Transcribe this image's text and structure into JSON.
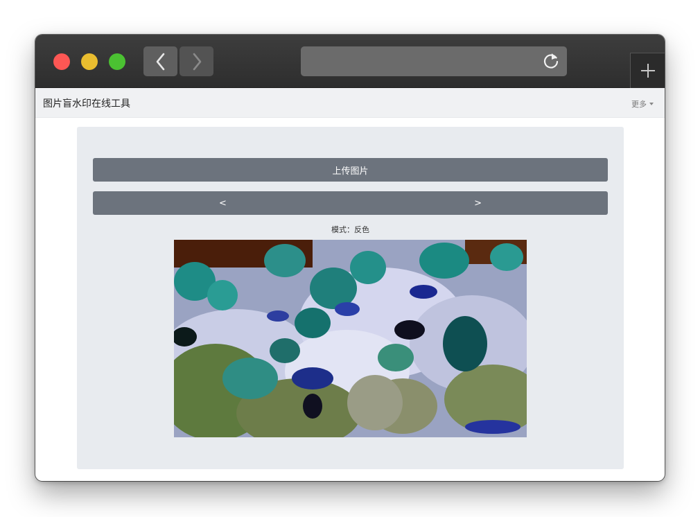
{
  "app": {
    "title": "图片盲水印在线工具",
    "more_label": "更多"
  },
  "toolbar": {
    "upload_label": "上传图片",
    "prev_label": "<",
    "next_label": ">"
  },
  "mode": {
    "text": "模式：反色"
  },
  "browser": {
    "back_icon": "chevron-left-icon",
    "forward_icon": "chevron-right-icon",
    "reload_icon": "reload-icon",
    "new_tab_icon": "plus-icon"
  },
  "colors": {
    "traffic_red": "#fd5754",
    "traffic_yellow": "#e9bd2f",
    "traffic_green": "#4bc132",
    "button_bg": "#6c737d",
    "panel_bg": "#e8ebef"
  }
}
